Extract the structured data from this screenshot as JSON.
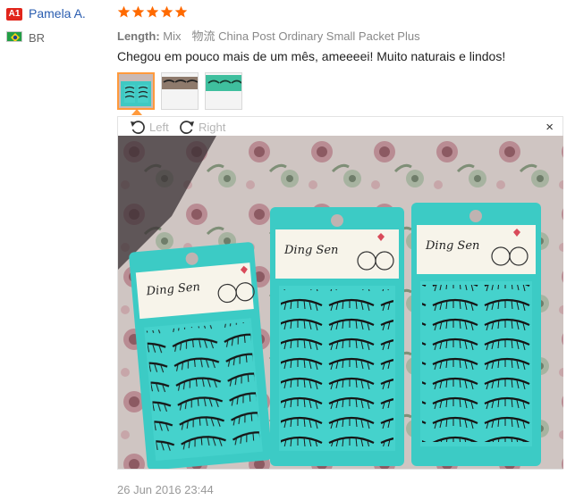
{
  "reviewer": {
    "badge": "A1",
    "name": "Pamela A.",
    "country": "BR"
  },
  "review": {
    "rating": 5,
    "length_label": "Length:",
    "length_value": "Mix",
    "shipping_label": "物流",
    "shipping_value": "China Post Ordinary Small Packet Plus",
    "text": "Chegou em pouco mais de um mês, ameeeei! Muito naturais e lindos!",
    "date": "26 Jun 2016 23:44"
  },
  "viewer": {
    "rotate_left": "Left",
    "rotate_right": "Right",
    "close": "×",
    "product_label_1": "Ding Sen",
    "product_label_2": "Ding Sen",
    "product_label_3": "Ding Sen"
  },
  "colors": {
    "star": "#ff6a00",
    "link": "#2a5db0",
    "active_thumb": "#ff9a3c",
    "package": "#3fc9c3"
  }
}
